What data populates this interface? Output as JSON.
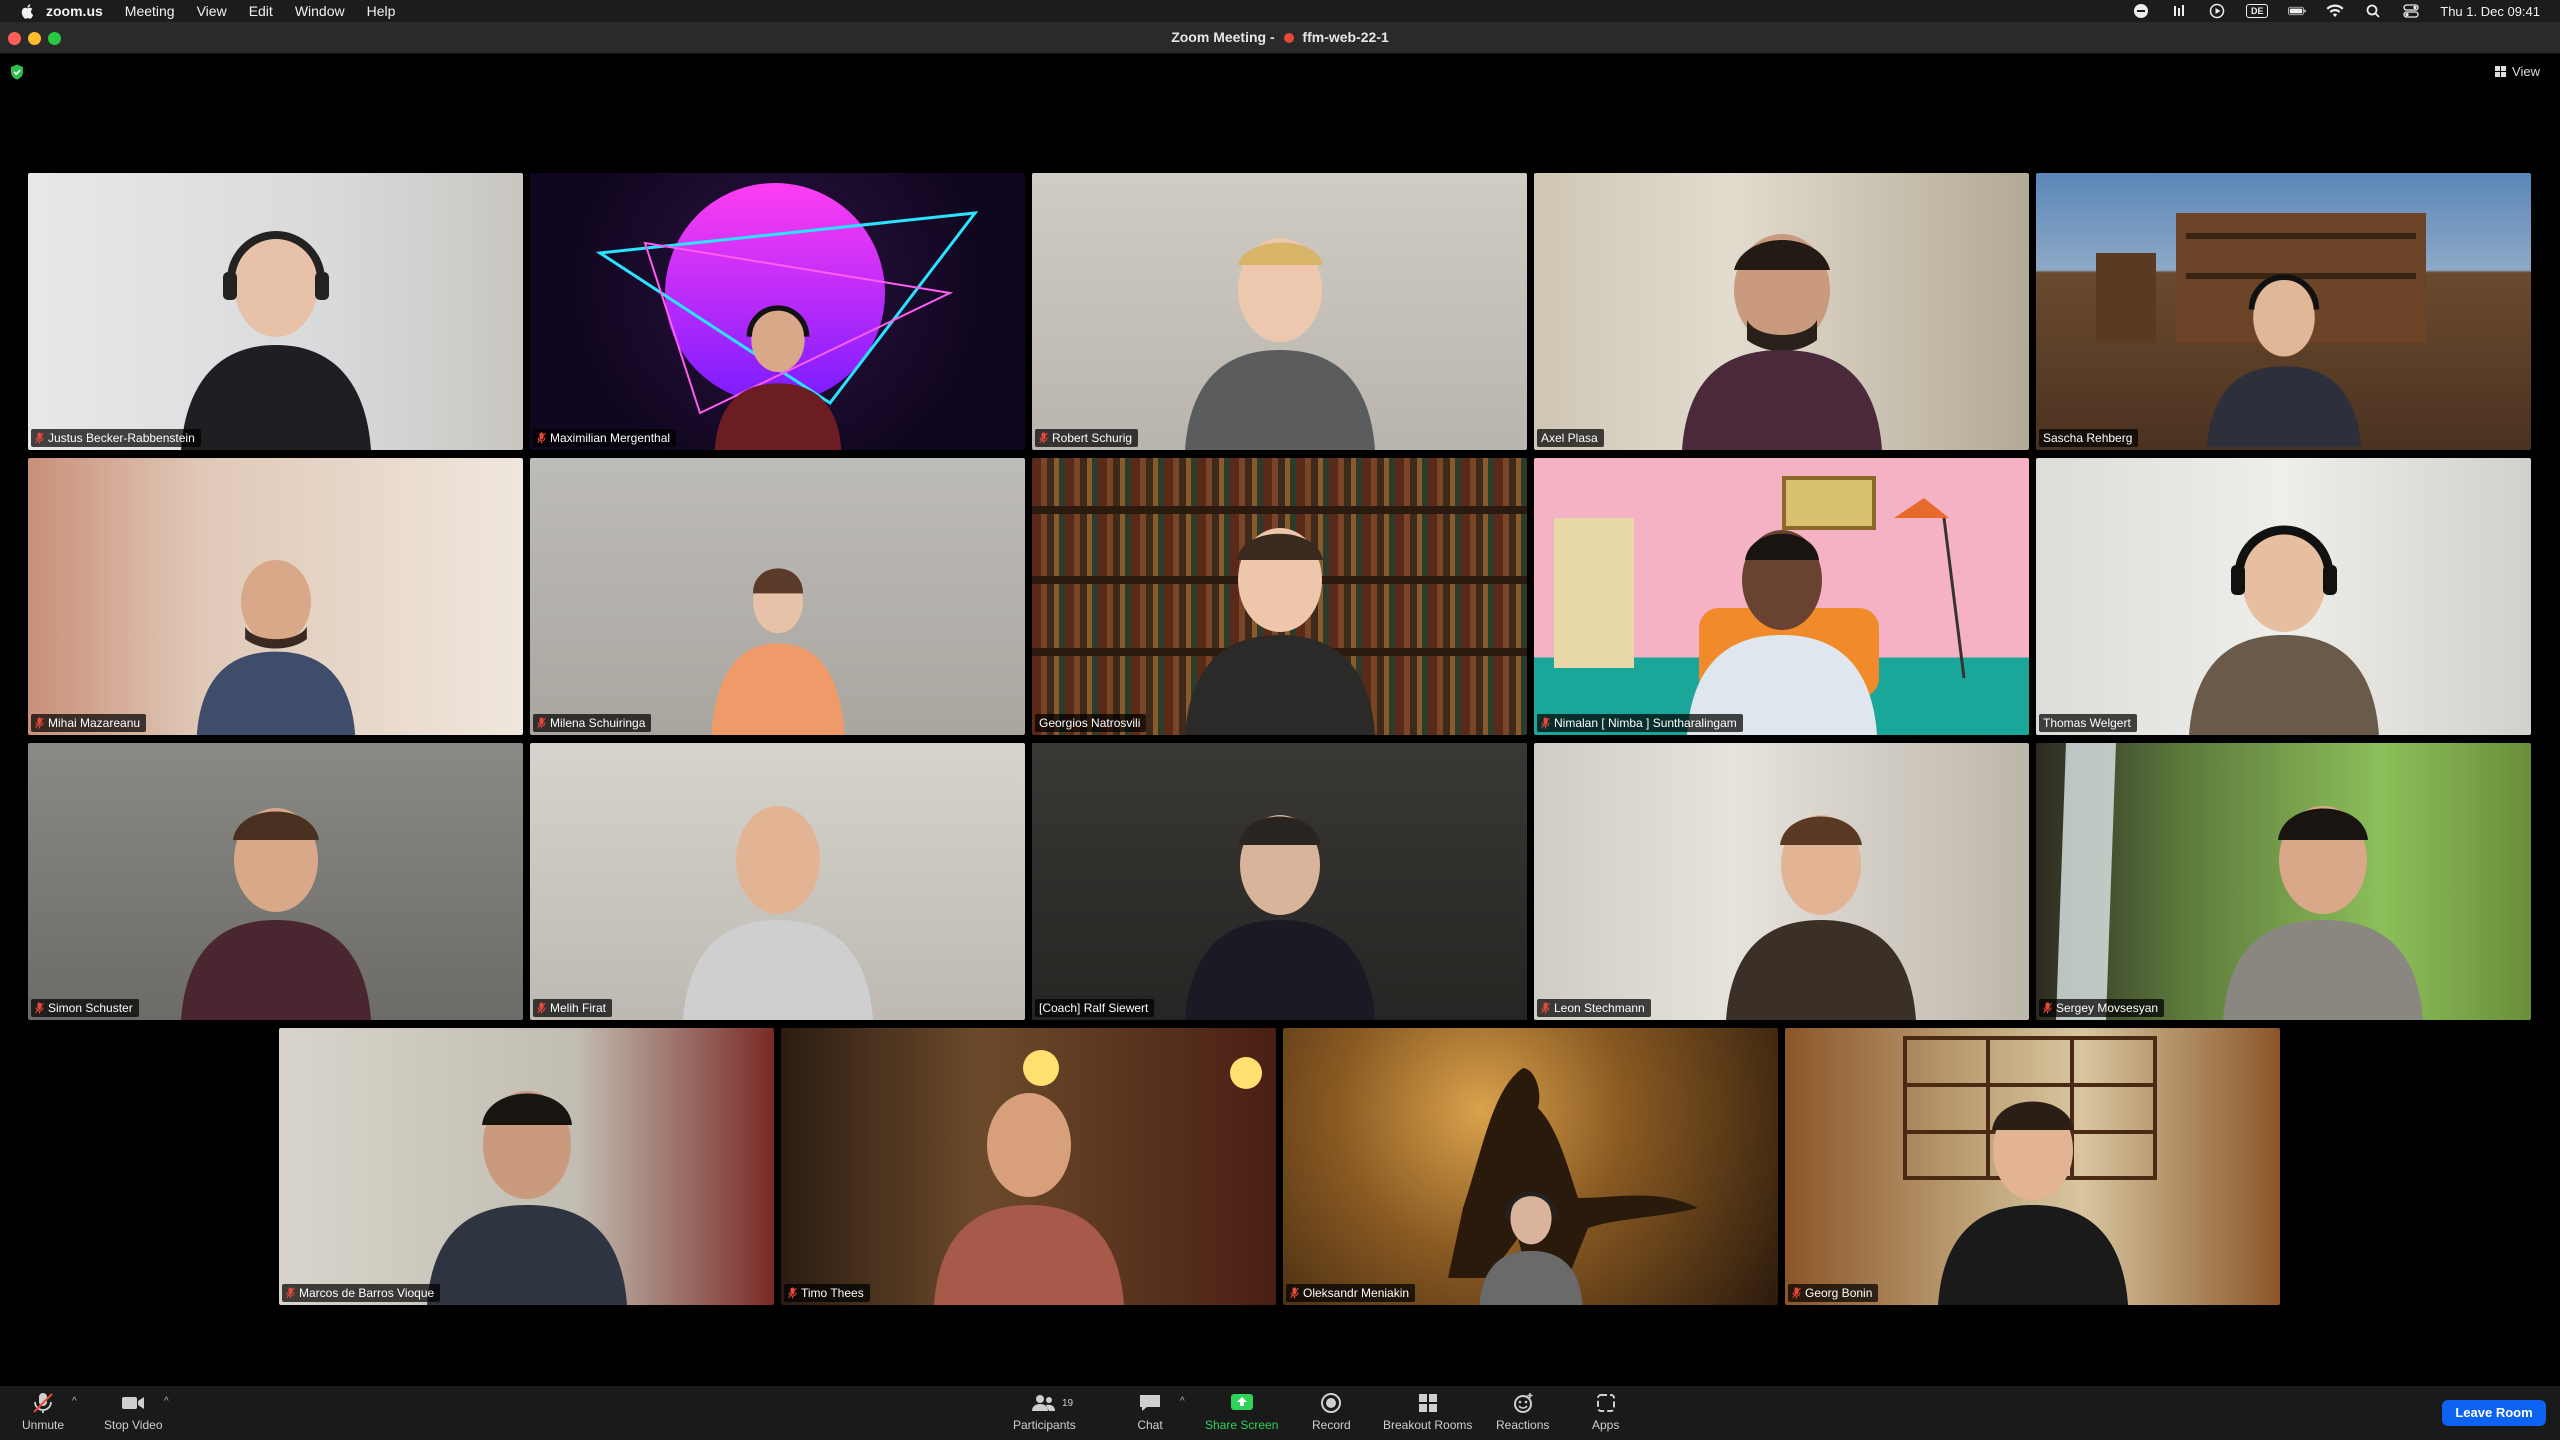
{
  "menubar": {
    "items": [
      "zoom.us",
      "Meeting",
      "View",
      "Edit",
      "Window",
      "Help"
    ],
    "status_icons": [
      "minus-circle-icon",
      "equalizer-icon",
      "play-circle-icon",
      "keyboard-de-icon",
      "battery-icon",
      "wifi-icon",
      "search-icon",
      "control-center-icon"
    ],
    "keyboard_layout": "DE",
    "clock": "Thu 1. Dec  09:41"
  },
  "window": {
    "title_prefix": "Zoom Meeting -",
    "title_room": "ffm-web-22-1"
  },
  "view_button": "View",
  "participants": [
    {
      "name": "Justus Becker-Rabbenstein",
      "muted": true,
      "active": false
    },
    {
      "name": "Maximilian Mergenthal",
      "muted": true,
      "active": false
    },
    {
      "name": "Robert Schurig",
      "muted": true,
      "active": false
    },
    {
      "name": "Axel Plasa",
      "muted": false,
      "active": false
    },
    {
      "name": "Sascha Rehberg",
      "muted": false,
      "active": false
    },
    {
      "name": "Mihai Mazareanu",
      "muted": true,
      "active": false
    },
    {
      "name": "Milena Schuiringa",
      "muted": true,
      "active": false
    },
    {
      "name": "Georgios Natrosvili",
      "muted": false,
      "active": false
    },
    {
      "name": "Nimalan [ Nimba ] Suntharalingam",
      "muted": true,
      "active": false
    },
    {
      "name": "Thomas Welgert",
      "muted": false,
      "active": false
    },
    {
      "name": "Simon Schuster",
      "muted": true,
      "active": false
    },
    {
      "name": "Melih Firat",
      "muted": true,
      "active": false
    },
    {
      "name": "[Coach] Ralf Siewert",
      "muted": false,
      "active": true
    },
    {
      "name": "Leon Stechmann",
      "muted": true,
      "active": false
    },
    {
      "name": "Sergey Movsesyan",
      "muted": true,
      "active": false
    },
    {
      "name": "Marcos de Barros Vioque",
      "muted": true,
      "active": false
    },
    {
      "name": "Timo Thees",
      "muted": true,
      "active": false
    },
    {
      "name": "Oleksandr Meniakin",
      "muted": true,
      "active": false
    },
    {
      "name": "Georg Bonin",
      "muted": true,
      "active": false
    }
  ],
  "toolbar": {
    "unmute": "Unmute",
    "stop_video": "Stop Video",
    "participants": "Participants",
    "participants_count": "19",
    "chat": "Chat",
    "share_screen": "Share Screen",
    "record": "Record",
    "breakout_rooms": "Breakout Rooms",
    "reactions": "Reactions",
    "apps": "Apps",
    "leave": "Leave Room"
  },
  "colors": {
    "active_speaker": "#2fd35a",
    "share_screen": "#2fd35a",
    "leave_button": "#0e62f2",
    "muted_mic": "#e8483a"
  }
}
